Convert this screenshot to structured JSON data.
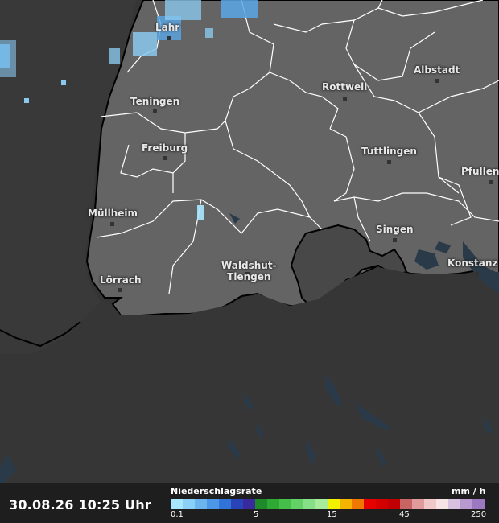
{
  "legend": {
    "title": "Niederschlagsrate",
    "unit": "mm / h",
    "ticks": [
      "0.1",
      "5",
      "15",
      "45",
      "250"
    ],
    "colors": [
      "#a8e8ff",
      "#8ad0f6",
      "#6cb4ee",
      "#4c98e6",
      "#2f74d6",
      "#2844b8",
      "#3a2aa0",
      "#1e8a2a",
      "#2eaa34",
      "#44c04a",
      "#62d266",
      "#86e08a",
      "#a6ec9a",
      "#f0f000",
      "#f4b400",
      "#f07800",
      "#e60000",
      "#d40000",
      "#c00000",
      "#c86464",
      "#e09c9c",
      "#f0c8c8",
      "#f6e4e4",
      "#d8c0e0",
      "#b89ad0",
      "#9c78c0"
    ]
  },
  "timestamp": "30.08.26 10:25 Uhr",
  "cities": [
    {
      "name": "Lahr"
    },
    {
      "name": "Teningen"
    },
    {
      "name": "Freiburg"
    },
    {
      "name": "Müllheim"
    },
    {
      "name": "Lörrach"
    },
    {
      "name": "Waldshut-\nTiengen"
    },
    {
      "name": "Rottweil"
    },
    {
      "name": "Albstadt"
    },
    {
      "name": "Tuttlingen"
    },
    {
      "name": "Singen"
    },
    {
      "name": "Pfullen"
    },
    {
      "name": "Konstanz"
    }
  ],
  "map_colors": {
    "land": "#646464",
    "outside": "#353535",
    "switzerland_enclave": "#4a4a4a",
    "water": "#2a3a48",
    "precip_light": "#8ac8ee",
    "precip_mid": "#5aa8e8"
  }
}
